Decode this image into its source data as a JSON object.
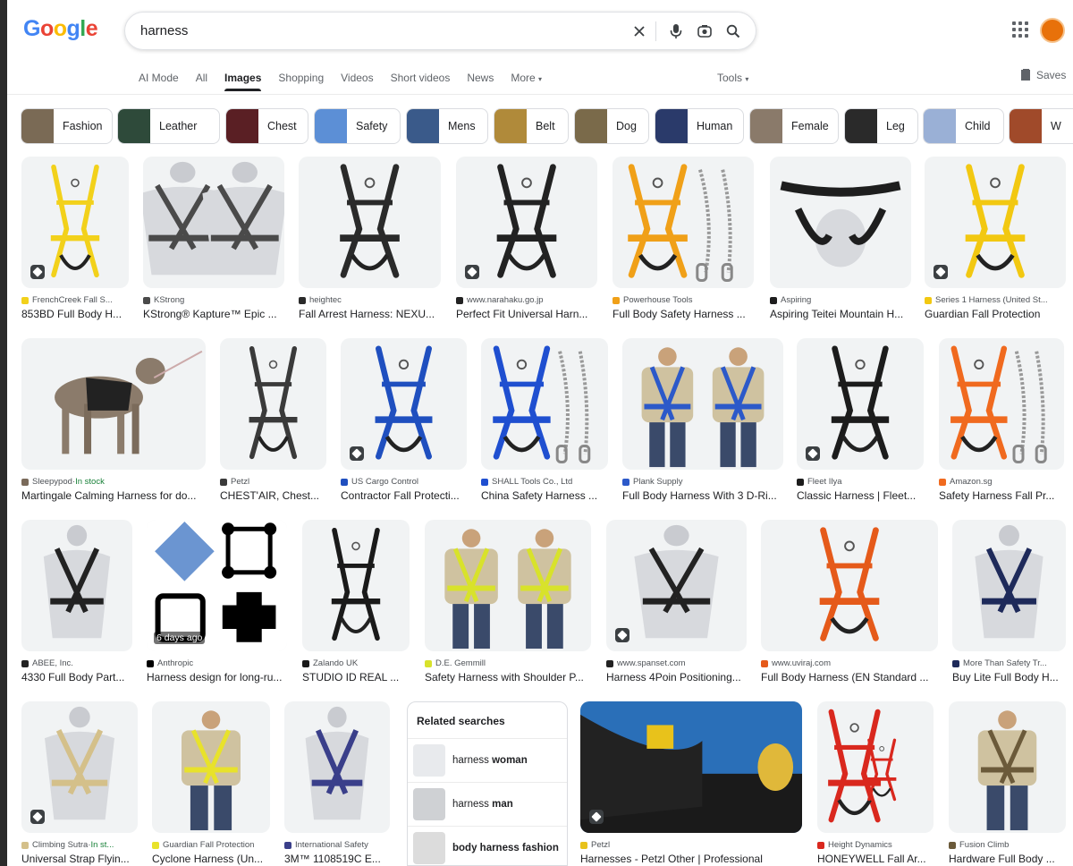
{
  "logo": {
    "letters": [
      "G",
      "o",
      "o",
      "g",
      "l",
      "e"
    ],
    "colors": [
      "#4285F4",
      "#EA4335",
      "#FBBC05",
      "#4285F4",
      "#34A853",
      "#EA4335"
    ]
  },
  "search": {
    "query": "harness"
  },
  "tabs": [
    "AI Mode",
    "All",
    "Images",
    "Shopping",
    "Videos",
    "Short videos",
    "News",
    "More"
  ],
  "active_tab": "Images",
  "tools_label": "Tools",
  "saves_label": "Saves",
  "chips": [
    "Fashion",
    "Leather",
    "Chest",
    "Safety",
    "Mens",
    "Belt",
    "Dog",
    "Human",
    "Female",
    "Leg",
    "Child",
    "W"
  ],
  "rows": [
    [
      {
        "source": "FrenchCreek Fall S...",
        "title": "853BD Full Body H...",
        "color": "#f2d11b",
        "kind": "harness"
      },
      {
        "source": "KStrong",
        "title": "KStrong® Kapture™ Epic ...",
        "color": "#4a4a4a",
        "kind": "mannequin2"
      },
      {
        "source": "heightec",
        "title": "Fall Arrest Harness: NEXU...",
        "color": "#2a2a2a",
        "kind": "harness"
      },
      {
        "source": "www.narahaku.go.jp",
        "title": "Perfect Fit Universal Harn...",
        "color": "#222222",
        "kind": "harness"
      },
      {
        "source": "Powerhouse Tools",
        "title": "Full Body Safety Harness ...",
        "color": "#f0a018",
        "kind": "lanyard"
      },
      {
        "source": "Aspiring",
        "title": "Aspiring Teitei Mountain H...",
        "color": "#1e1e1e",
        "kind": "seat"
      },
      {
        "source": "Series 1 Harness (United St...",
        "title": "Guardian Fall Protection",
        "color": "#f2c811",
        "kind": "harness"
      }
    ],
    [
      {
        "source": "Sleepypod",
        "stock": "In stock",
        "title": "Martingale Calming Harness for do...",
        "color": "#7a6a5a",
        "kind": "dog"
      },
      {
        "source": "Petzl",
        "title": "CHEST'AIR, Chest...",
        "color": "#3a3a3a",
        "kind": "harness"
      },
      {
        "source": "US Cargo Control",
        "title": "Contractor Fall Protecti...",
        "color": "#1f4fbf",
        "kind": "harness"
      },
      {
        "source": "SHALL Tools Co., Ltd",
        "title": "China Safety Harness ...",
        "color": "#1f4fd0",
        "kind": "lanyard"
      },
      {
        "source": "Plank Supply",
        "title": "Full Body Harness With 3 D-Ri...",
        "color": "#2c59c9",
        "kind": "people2"
      },
      {
        "source": "Fleet Ilya",
        "title": "Classic Harness | Fleet...",
        "color": "#1c1c1c",
        "kind": "harness"
      },
      {
        "source": "Amazon.sg",
        "title": "Safety Harness Fall Pr...",
        "color": "#f06a1f",
        "kind": "lanyard"
      }
    ],
    [
      {
        "source": "ABEE, Inc.",
        "title": "4330 Full Body Part...",
        "color": "#222222",
        "kind": "mannequin"
      },
      {
        "source": "Anthropic",
        "title": "Harness design for long-ru...",
        "color": "#000000",
        "kind": "shapes",
        "ago": "6 days ago"
      },
      {
        "source": "Zalando UK",
        "title": "STUDIO ID REAL ...",
        "color": "#1a1a1a",
        "kind": "harness"
      },
      {
        "source": "D.E. Gemmill",
        "title": "Safety Harness with Shoulder P...",
        "color": "#d8e22b",
        "kind": "people2"
      },
      {
        "source": "www.spanset.com",
        "title": "Harness 4Poin Positioning...",
        "color": "#222222",
        "kind": "mannequin"
      },
      {
        "source": "www.uviraj.com",
        "title": "Full Body Harness (EN Standard ...",
        "color": "#e55a1a",
        "kind": "harness"
      },
      {
        "source": "More Than Safety Tr...",
        "title": "Buy Lite Full Body H...",
        "color": "#1e2a5a",
        "kind": "mannequin"
      }
    ],
    [
      {
        "source": "Climbing Sutra",
        "stock": "In st...",
        "title": "Universal Strap Flyin...",
        "color": "#d4c08a",
        "kind": "mannequin"
      },
      {
        "source": "Guardian Fall Protection",
        "title": "Cyclone Harness (Un...",
        "color": "#e8e22b",
        "kind": "person"
      },
      {
        "source": "International Safety",
        "title": "3M™ 1108519C E...",
        "color": "#3a3f8a",
        "kind": "mannequin"
      },
      {
        "source": "Petzl",
        "title": "Harnesses - Petzl Other | Professional",
        "color": "#e8c21b",
        "kind": "photo"
      },
      {
        "source": "Height Dynamics",
        "title": "HONEYWELL Fall Ar...",
        "color": "#d9281e",
        "kind": "harness2"
      },
      {
        "source": "Fusion Climb",
        "title": "Hardware Full Body ...",
        "color": "#6b5a3a",
        "kind": "person"
      }
    ]
  ],
  "related": {
    "heading": "Related searches",
    "items": [
      {
        "prefix": "harness ",
        "bold": "woman"
      },
      {
        "prefix": "harness ",
        "bold": "man"
      },
      {
        "prefix": "",
        "bold": "body harness fashion"
      }
    ]
  }
}
